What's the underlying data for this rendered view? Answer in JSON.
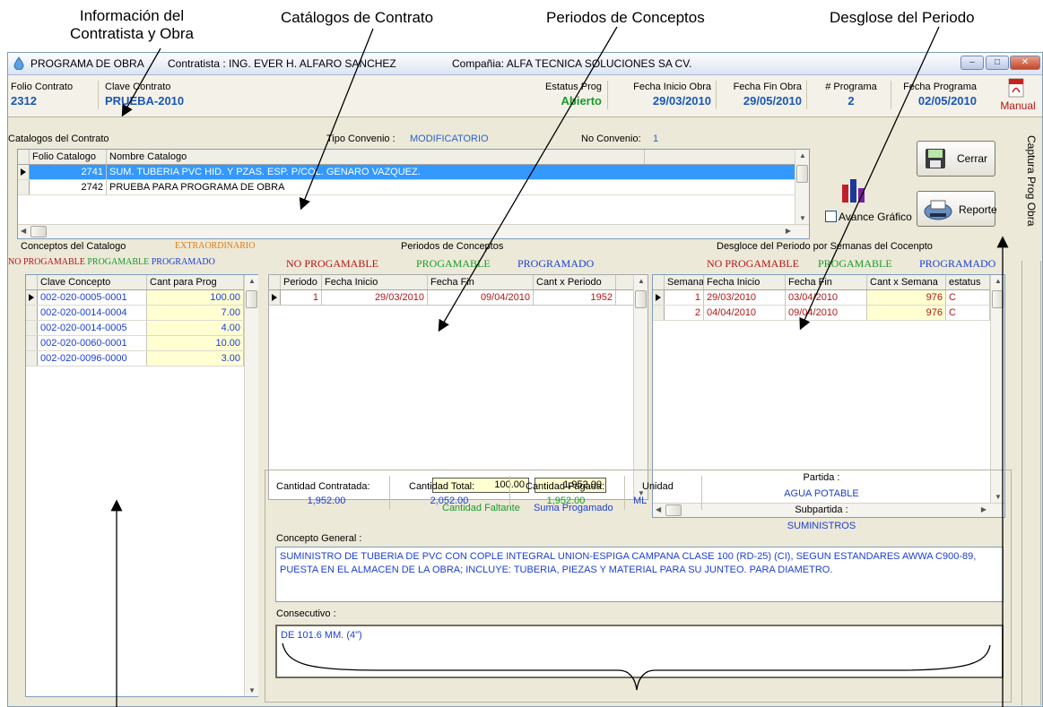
{
  "callouts": {
    "info": [
      "Información del",
      "Contratista y Obra"
    ],
    "catalogos": "Catálogos de Contrato",
    "periodos": "Periodos de Conceptos",
    "desglose": "Desglose del Periodo"
  },
  "window": {
    "title": "PROGRAMA DE OBRA",
    "contratista": "Contratista : ING. EVER H. ALFARO SANCHEZ",
    "compania": "Compañia: ALFA TECNICA SOLUCIONES SA CV."
  },
  "header": {
    "folio_contrato_label": "Folio Contrato",
    "folio_contrato": "2312",
    "clave_contrato_label": "Clave Contrato",
    "clave_contrato": "PRUEBA-2010",
    "estatus_label": "Estatus Prog",
    "estatus": "Abierto",
    "fecha_inicio_label": "Fecha Inicio Obra",
    "fecha_inicio": "29/03/2010",
    "fecha_fin_label": "Fecha Fin Obra",
    "fecha_fin": "29/05/2010",
    "num_programa_label": "# Programa",
    "num_programa": "2",
    "fecha_programa_label": "Fecha Programa",
    "fecha_programa": "02/05/2010",
    "manual_label": "Manual"
  },
  "catalogos": {
    "section_label": "Catalogos del Contrato",
    "tipo_convenio_label": "Tipo Convenio :",
    "tipo_convenio": "MODIFICATORIO",
    "no_convenio_label": "No Convenio:",
    "no_convenio": "1",
    "columns": [
      "Folio Catalogo",
      "Nombre Catalogo"
    ],
    "rows": [
      {
        "folio": "2741",
        "nombre": "SUM. TUBERIA PVC HID. Y PZAS. ESP. P/COL. GENARO VAZQUEZ."
      },
      {
        "folio": "2742",
        "nombre": "PRUEBA PARA PROGRAMA DE OBRA"
      }
    ]
  },
  "buttons": {
    "cerrar": "Cerrar",
    "reporte": "Reporte",
    "avance": "Avance Gráfico"
  },
  "side_tab": "Captura Prog Obra",
  "legend": {
    "no_programable": "NO PROGAMABLE",
    "programable": "PROGAMABLE",
    "programado": "PROGRAMADO",
    "extraordinario": "EXTRAORDINARIO",
    "no_programable_big": "NO PROGAMABLE",
    "programable_big": "PROGAMABLE",
    "programado_big": "PROGRAMADO"
  },
  "conceptos": {
    "title": "Conceptos del Catalogo",
    "columns": [
      "Clave Concepto",
      "Cant para Prog"
    ],
    "rows": [
      {
        "clave": "002-020-0005-0001",
        "cant": "100.00"
      },
      {
        "clave": "002-020-0014-0004",
        "cant": "7.00"
      },
      {
        "clave": "002-020-0014-0005",
        "cant": "4.00"
      },
      {
        "clave": "002-020-0060-0001",
        "cant": "10.00"
      },
      {
        "clave": "002-020-0096-0000",
        "cant": "3.00"
      }
    ]
  },
  "periodos": {
    "title": "Periodos de Conceptos",
    "columns": [
      "Periodo",
      "Fecha Inicio",
      "Fecha Fin",
      "Cant x Periodo"
    ],
    "rows": [
      {
        "periodo": "1",
        "inicio": "29/03/2010",
        "fin": "09/04/2010",
        "cant": "1952"
      }
    ],
    "cantidad_faltante": "100.00",
    "suma_programado": "1,952.00",
    "cantidad_faltante_label": "Cantidad Faltante",
    "suma_programado_label": "Suma Progamado"
  },
  "desglose": {
    "title": "Desgloce del Periodo por Semanas del Cocenpto",
    "columns": [
      "Semana",
      "Fecha Inicio",
      "Fecha Fin",
      "Cant x Semana",
      "estatus"
    ],
    "rows": [
      {
        "semana": "1",
        "inicio": "29/03/2010",
        "fin": "03/04/2010",
        "cant": "976",
        "estatus": "C"
      },
      {
        "semana": "2",
        "inicio": "04/04/2010",
        "fin": "09/04/2010",
        "cant": "976",
        "estatus": "C"
      }
    ]
  },
  "detalle": {
    "cantidad_contratada_label": "Cantidad Contratada:",
    "cantidad_contratada": "1,952.00",
    "cantidad_total_label": "Cantidad Total:",
    "cantidad_total": "2,052.00",
    "cantidad_pagada_label": "Cantidad Pagada:",
    "cantidad_pagada": "1,952.00",
    "unidad_label": "Unidad",
    "unidad": "ML",
    "partida_label": "Partida :",
    "partida": "AGUA POTABLE",
    "subpartida_label": "Subpartida :",
    "subpartida": "SUMINISTROS",
    "concepto_general_label": "Concepto General :",
    "concepto_general": "SUMINISTRO DE TUBERIA DE PVC CON COPLE INTEGRAL UNION-ESPIGA CAMPANA CLASE 100 (RD-25) (CI), SEGUN ESTANDARES AWWA C900-89, PUESTA EN EL ALMACEN DE LA OBRA; INCLUYE: TUBERIA, PIEZAS Y MATERIAL PARA SU JUNTEO. PARA DIAMETRO.",
    "consecutivo_label": "Consecutivo :",
    "consecutivo": "DE 101.6 MM. (4\")"
  }
}
